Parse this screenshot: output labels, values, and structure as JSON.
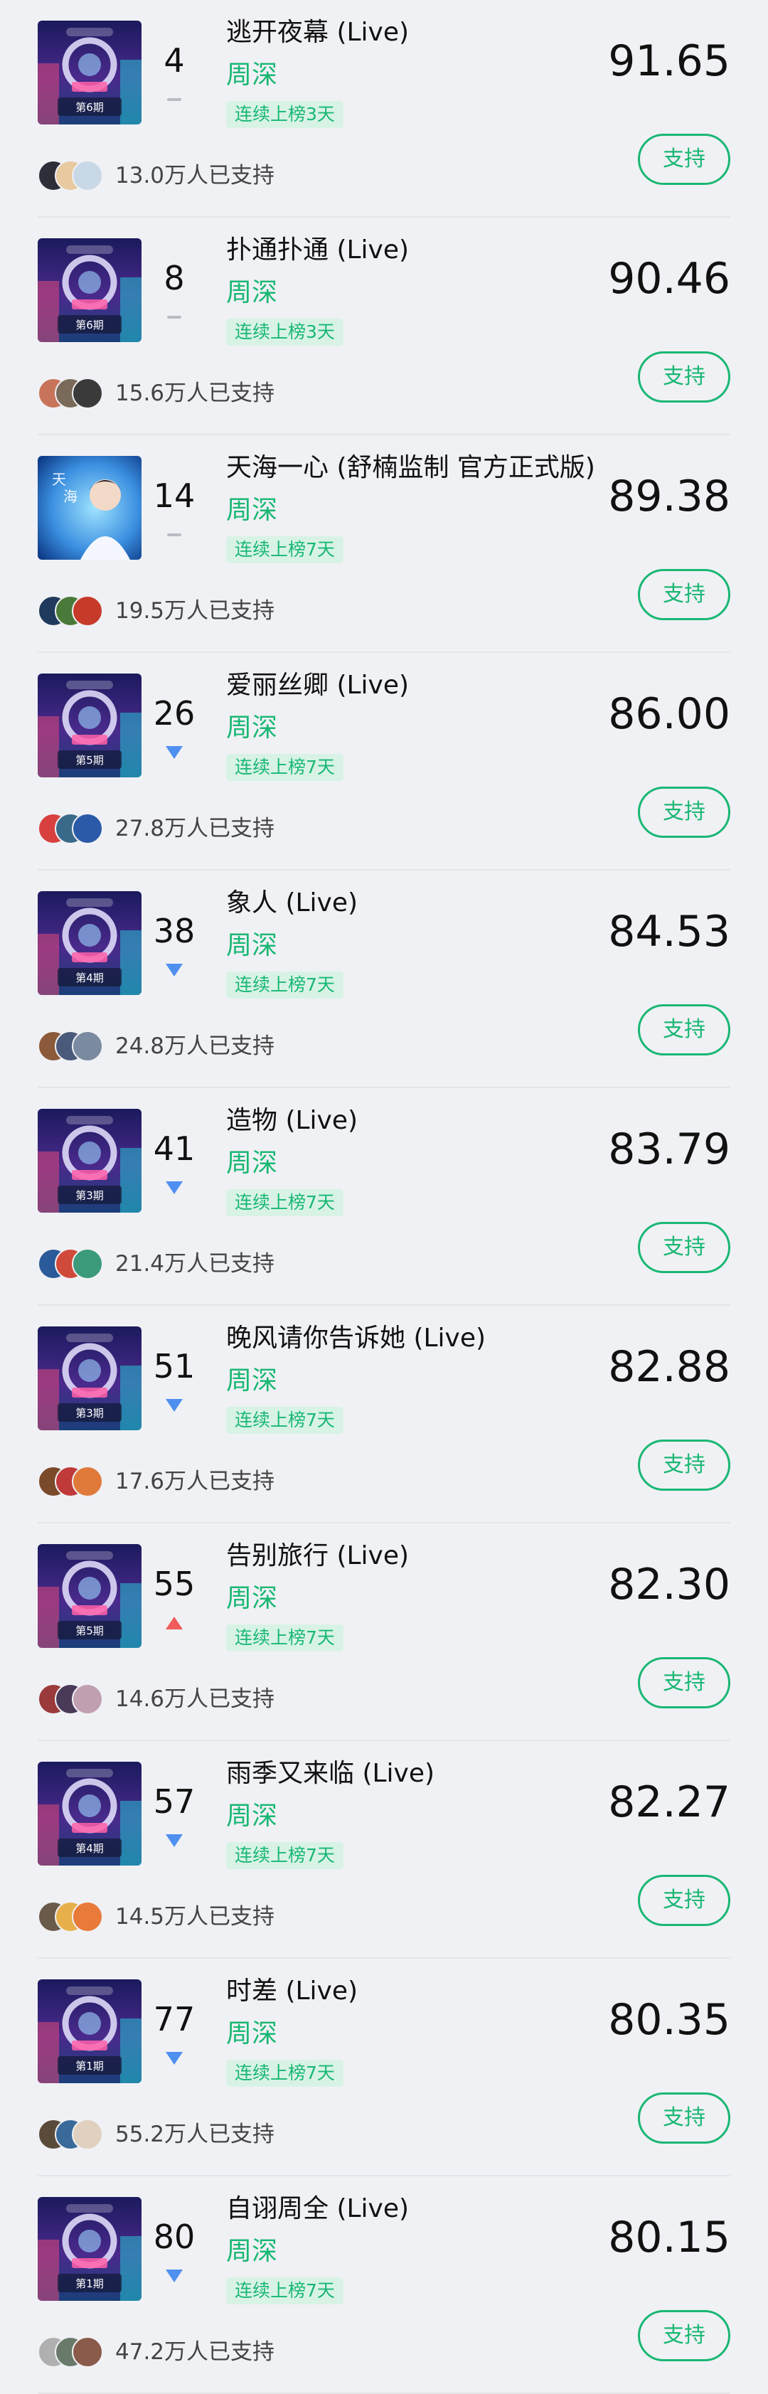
{
  "ui": {
    "streak_label_default": "连续上榜7天",
    "support_label": "支持",
    "accent_color": "#19b774",
    "down_color": "#4f8ff0",
    "up_color": "#f05b5b"
  },
  "items": [
    {
      "rank": "4",
      "trend": "flat",
      "title": "逃开夜幕 (Live)",
      "artist": "周深",
      "streak": "连续上榜3天",
      "score": "91.65",
      "supporters": "13.0万人已支持",
      "support": "支持",
      "cover": "show",
      "cover_episode": "第6期"
    },
    {
      "rank": "8",
      "trend": "flat",
      "title": "扑通扑通 (Live)",
      "artist": "周深",
      "streak": "连续上榜3天",
      "score": "90.46",
      "supporters": "15.6万人已支持",
      "support": "支持",
      "cover": "show",
      "cover_episode": "第6期"
    },
    {
      "rank": "14",
      "trend": "flat",
      "title": "天海一心 (舒楠监制 官方正式版)",
      "artist": "周深",
      "streak": "连续上榜7天",
      "score": "89.38",
      "supporters": "19.5万人已支持",
      "support": "支持",
      "cover": "portrait",
      "cover_episode": ""
    },
    {
      "rank": "26",
      "trend": "down",
      "title": "爱丽丝卿 (Live)",
      "artist": "周深",
      "streak": "连续上榜7天",
      "score": "86.00",
      "supporters": "27.8万人已支持",
      "support": "支持",
      "cover": "show",
      "cover_episode": "第5期"
    },
    {
      "rank": "38",
      "trend": "down",
      "title": "象人 (Live)",
      "artist": "周深",
      "streak": "连续上榜7天",
      "score": "84.53",
      "supporters": "24.8万人已支持",
      "support": "支持",
      "cover": "show",
      "cover_episode": "第4期"
    },
    {
      "rank": "41",
      "trend": "down",
      "title": "造物 (Live)",
      "artist": "周深",
      "streak": "连续上榜7天",
      "score": "83.79",
      "supporters": "21.4万人已支持",
      "support": "支持",
      "cover": "show",
      "cover_episode": "第3期"
    },
    {
      "rank": "51",
      "trend": "down",
      "title": "晚风请你告诉她 (Live)",
      "artist": "周深",
      "streak": "连续上榜7天",
      "score": "82.88",
      "supporters": "17.6万人已支持",
      "support": "支持",
      "cover": "show",
      "cover_episode": "第3期"
    },
    {
      "rank": "55",
      "trend": "up",
      "title": "告别旅行 (Live)",
      "artist": "周深",
      "streak": "连续上榜7天",
      "score": "82.30",
      "supporters": "14.6万人已支持",
      "support": "支持",
      "cover": "show",
      "cover_episode": "第5期"
    },
    {
      "rank": "57",
      "trend": "down",
      "title": "雨季又来临 (Live)",
      "artist": "周深",
      "streak": "连续上榜7天",
      "score": "82.27",
      "supporters": "14.5万人已支持",
      "support": "支持",
      "cover": "show",
      "cover_episode": "第4期"
    },
    {
      "rank": "77",
      "trend": "down",
      "title": "时差 (Live)",
      "artist": "周深",
      "streak": "连续上榜7天",
      "score": "80.35",
      "supporters": "55.2万人已支持",
      "support": "支持",
      "cover": "show",
      "cover_episode": "第1期"
    },
    {
      "rank": "80",
      "trend": "down",
      "title": "自诩周全 (Live)",
      "artist": "周深",
      "streak": "连续上榜7天",
      "score": "80.15",
      "supporters": "47.2万人已支持",
      "support": "支持",
      "cover": "show",
      "cover_episode": "第1期"
    }
  ]
}
